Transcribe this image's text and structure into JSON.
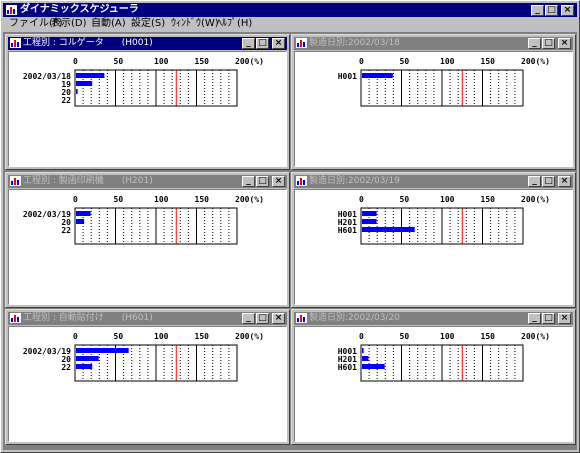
{
  "app": {
    "title": "ダイナミックスケジューラ",
    "window_buttons": {
      "minimize": "_",
      "maximize": "□",
      "close": "×"
    }
  },
  "menu": [
    {
      "label": "ファイル(F)"
    },
    {
      "label": "表示(D)"
    },
    {
      "label": "自動(A)"
    },
    {
      "label": "設定(S)"
    },
    {
      "label": "ｳｨﾝﾄﾞｳ(W)"
    },
    {
      "label": "ﾍﾙﾌﾟ(H)"
    }
  ],
  "colors": {
    "bar": "#0000ff",
    "redline": "#ff0000",
    "grid": "#000000"
  },
  "windows": [
    {
      "title": "工程別 : コルゲータ　　(H001)",
      "active": true,
      "chart_data": {
        "type": "bar",
        "orientation": "horizontal",
        "xlim": [
          0,
          200
        ],
        "ticks": [
          "0",
          "50",
          "100",
          "150",
          "200(%)"
        ],
        "redline": 125,
        "categories": [
          "2002/03/18",
          "19",
          "20",
          "22"
        ],
        "values": [
          35,
          20,
          2,
          0
        ]
      }
    },
    {
      "title": "製造日別:2002/03/18",
      "active": false,
      "chart_data": {
        "type": "bar",
        "orientation": "horizontal",
        "xlim": [
          0,
          200
        ],
        "ticks": [
          "0",
          "50",
          "100",
          "150",
          "200(%)"
        ],
        "redline": 125,
        "categories": [
          "H001"
        ],
        "values": [
          38
        ]
      }
    },
    {
      "title": "工程別 : 製函印刷機　　(H201)",
      "active": false,
      "chart_data": {
        "type": "bar",
        "orientation": "horizontal",
        "xlim": [
          0,
          200
        ],
        "ticks": [
          "0",
          "50",
          "100",
          "150",
          "200(%)"
        ],
        "redline": 125,
        "categories": [
          "2002/03/19",
          "20",
          "22"
        ],
        "values": [
          18,
          10,
          0
        ]
      }
    },
    {
      "title": "製造日別:2002/03/19",
      "active": false,
      "chart_data": {
        "type": "bar",
        "orientation": "horizontal",
        "xlim": [
          0,
          200
        ],
        "ticks": [
          "0",
          "50",
          "100",
          "150",
          "200(%)"
        ],
        "redline": 125,
        "categories": [
          "H001",
          "H201",
          "H601"
        ],
        "values": [
          18,
          18,
          65
        ]
      }
    },
    {
      "title": "工程別 : 自動貼付け　　(H601)",
      "active": false,
      "chart_data": {
        "type": "bar",
        "orientation": "horizontal",
        "xlim": [
          0,
          200
        ],
        "ticks": [
          "0",
          "50",
          "100",
          "150",
          "200(%)"
        ],
        "redline": 125,
        "categories": [
          "2002/03/19",
          "20",
          "22"
        ],
        "values": [
          65,
          28,
          20
        ]
      }
    },
    {
      "title": "製造日別:2002/03/20",
      "active": false,
      "chart_data": {
        "type": "bar",
        "orientation": "horizontal",
        "xlim": [
          0,
          200
        ],
        "ticks": [
          "0",
          "50",
          "100",
          "150",
          "200(%)"
        ],
        "redline": 125,
        "categories": [
          "H001",
          "H201",
          "H601"
        ],
        "values": [
          2,
          8,
          28
        ]
      }
    }
  ]
}
